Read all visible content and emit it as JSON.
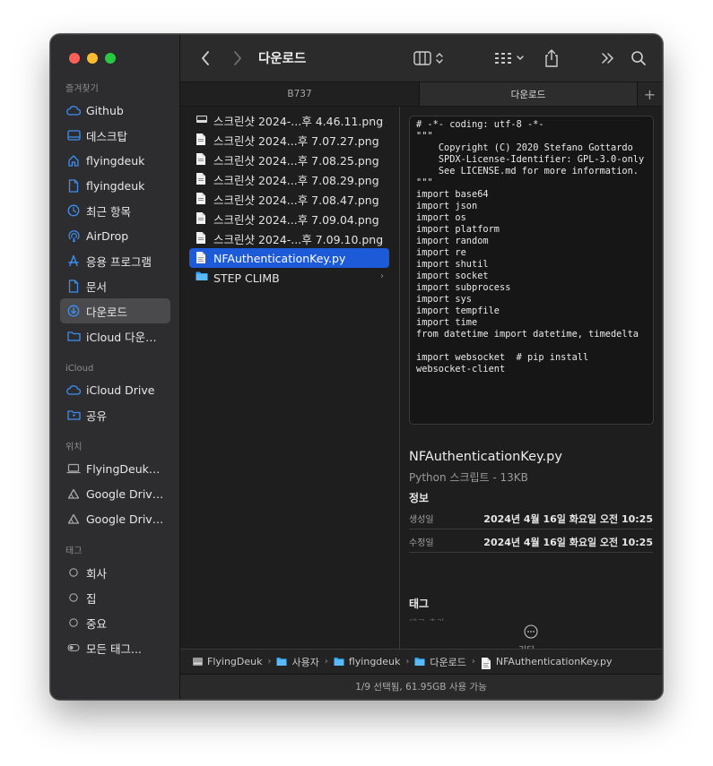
{
  "toolbar": {
    "title": "다운로드"
  },
  "sidebar": {
    "favorites_heading": "즐겨찾기",
    "favorites": [
      {
        "label": "Github",
        "icon": "cloud-icon"
      },
      {
        "label": "데스크탑",
        "icon": "desktop-icon"
      },
      {
        "label": "flyingdeuk",
        "icon": "home-icon"
      },
      {
        "label": "flyingdeuk",
        "icon": "document-icon"
      },
      {
        "label": "최근 항목",
        "icon": "clock-icon"
      },
      {
        "label": "AirDrop",
        "icon": "airdrop-icon"
      },
      {
        "label": "응용 프로그램",
        "icon": "applications-icon"
      },
      {
        "label": "문서",
        "icon": "document-icon"
      },
      {
        "label": "다운로드",
        "icon": "downloads-icon",
        "active": true
      },
      {
        "label": "iCloud 다운…",
        "icon": "folder-icon"
      }
    ],
    "icloud_heading": "iCloud",
    "icloud": [
      {
        "label": "iCloud Drive",
        "icon": "cloud-icon"
      },
      {
        "label": "공유",
        "icon": "shared-folder-icon"
      }
    ],
    "locations_heading": "위치",
    "locations": [
      {
        "label": "FlyingDeuk…",
        "icon": "laptop-icon"
      },
      {
        "label": "Google Driv…",
        "icon": "drive-icon"
      },
      {
        "label": "Google Driv…",
        "icon": "drive-icon"
      }
    ],
    "tags_heading": "태그",
    "tags": [
      {
        "label": "회사",
        "icon": "tag-circle-icon"
      },
      {
        "label": "집",
        "icon": "tag-circle-icon"
      },
      {
        "label": "중요",
        "icon": "tag-circle-icon"
      },
      {
        "label": "모든 태그...",
        "icon": "all-tags-icon"
      }
    ]
  },
  "tabs": [
    {
      "label": "B737",
      "active": false
    },
    {
      "label": "다운로드",
      "active": true
    }
  ],
  "files": [
    {
      "name": "스크린샷 2024-...후 4.46.11.png",
      "icon": "screenshot-icon"
    },
    {
      "name": "스크린샷 2024...후 7.07.27.png",
      "icon": "image-file-icon"
    },
    {
      "name": "스크린샷 2024...후 7.08.25.png",
      "icon": "image-file-icon"
    },
    {
      "name": "스크린샷 2024...후 7.08.29.png",
      "icon": "image-file-icon"
    },
    {
      "name": "스크린샷 2024...후 7.08.47.png",
      "icon": "image-file-icon"
    },
    {
      "name": "스크린샷 2024...후 7.09.04.png",
      "icon": "image-file-icon"
    },
    {
      "name": "스크린샷 2024-...후 7.09.10.png",
      "icon": "image-file-icon"
    },
    {
      "name": "NFAuthenticationKey.py",
      "icon": "python-file-icon",
      "selected": true
    },
    {
      "name": "STEP CLIMB",
      "icon": "folder-icon",
      "folder": true
    }
  ],
  "preview": {
    "code": "# -*- coding: utf-8 -*-\n\"\"\"\n    Copyright (C) 2020 Stefano Gottardo\n    SPDX-License-Identifier: GPL-3.0-only\n    See LICENSE.md for more information.\n\"\"\"\nimport base64\nimport json\nimport os\nimport platform\nimport random\nimport re\nimport shutil\nimport socket\nimport subprocess\nimport sys\nimport tempfile\nimport time\nfrom datetime import datetime, timedelta\n\nimport websocket  # pip install websocket-client",
    "name": "NFAuthenticationKey.py",
    "kind": "Python 스크립트 - 13KB",
    "info_heading": "정보",
    "created_label": "생성일",
    "created_value": "2024년 4월 16일 화요일 오전 10:25",
    "modified_label": "수정일",
    "modified_value": "2024년 4월 16일 화요일 오전 10:25",
    "tags_heading": "태그",
    "tags_add": "태그 추가...",
    "more_label": "기타..."
  },
  "pathbar": [
    {
      "label": "FlyingDeuk",
      "icon": "disk-icon"
    },
    {
      "label": "사용자",
      "icon": "folder-icon"
    },
    {
      "label": "flyingdeuk",
      "icon": "folder-icon"
    },
    {
      "label": "다운로드",
      "icon": "folder-icon"
    },
    {
      "label": "NFAuthenticationKey.py",
      "icon": "python-file-icon"
    }
  ],
  "status": "1/9 선택됨, 61.95GB 사용 가능",
  "colors": {
    "accent": "#1d5ad8",
    "sidebar_icon": "#3d8ef2"
  }
}
